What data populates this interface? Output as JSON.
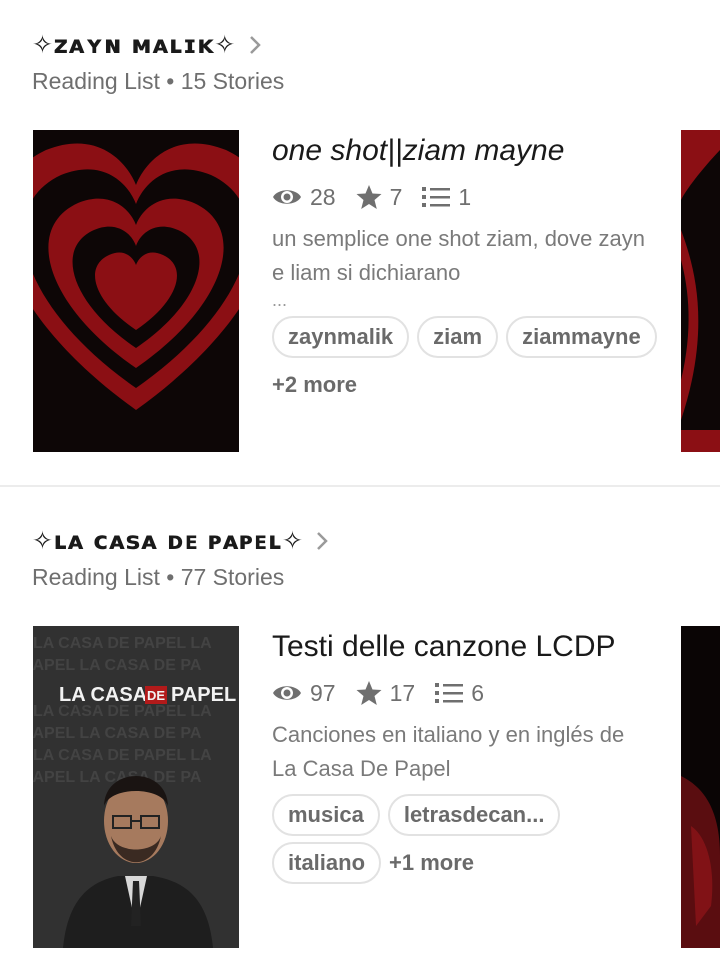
{
  "lists": [
    {
      "title": "✧ᴢᴀʏɴ ᴍᴀʟɪᴋ✧",
      "meta": "Reading List • 15 Stories",
      "story": {
        "title": "one shot||ziam mayne",
        "views": "28",
        "votes": "7",
        "parts": "1",
        "description": "un semplice one shot ziam, dove zayn e liam si dichiarano",
        "ellipsis": "...",
        "tags": [
          "zaynmalik",
          "ziam",
          "ziammayne"
        ],
        "more_tags": "+2 more"
      }
    },
    {
      "title": "✧ʟᴀ ᴄᴀsᴀ ᴅᴇ ᴘᴀᴘᴇʟ✧",
      "meta": "Reading List • 77 Stories",
      "story": {
        "title": "Testi delle canzone LCDP",
        "views": "97",
        "votes": "17",
        "parts": "6",
        "description": "Canciones en italiano y en inglés de La Casa De Papel",
        "cover_text": "LA CASA DE PAPEL",
        "cover_text_a": "LA CASA",
        "cover_text_b": "DE",
        "cover_text_c": "PAPEL",
        "tags": [
          "musica",
          "letrasdecan...",
          "italiano"
        ],
        "more_tags": "+1 more"
      }
    }
  ],
  "colors": {
    "accent_red": "#8b0f14",
    "dark": "#0d0606",
    "text_secondary": "#6f6f6f"
  },
  "icons": [
    "eye-icon",
    "star-icon",
    "list-icon",
    "chevron-right-icon"
  ]
}
